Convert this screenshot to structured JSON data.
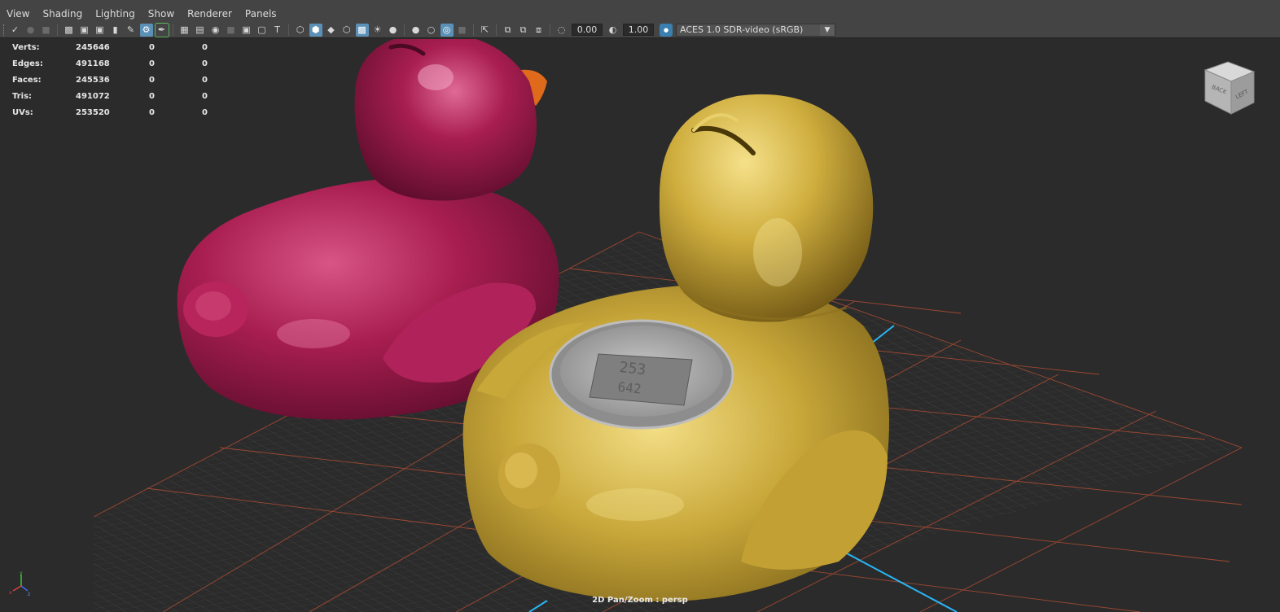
{
  "menubar": {
    "items": [
      "View",
      "Shading",
      "Lighting",
      "Show",
      "Renderer",
      "Panels"
    ]
  },
  "toolbar": {
    "exposure": "0.00",
    "gamma": "1.00",
    "color_space": "ACES 1.0 SDR-video (sRGB)"
  },
  "hud": {
    "rows": [
      {
        "label": "Verts:",
        "value": "245646",
        "z1": "0",
        "z2": "0"
      },
      {
        "label": "Edges:",
        "value": "491168",
        "z1": "0",
        "z2": "0"
      },
      {
        "label": "Faces:",
        "value": "245536",
        "z1": "0",
        "z2": "0"
      },
      {
        "label": "Tris:",
        "value": "491072",
        "z1": "0",
        "z2": "0"
      },
      {
        "label": "UVs:",
        "value": "253520",
        "z1": "0",
        "z2": "0"
      }
    ]
  },
  "viewcube": {
    "face_back": "BACK",
    "face_left": "LEFT"
  },
  "camera_label": "2D Pan/Zoom : persp",
  "colors": {
    "panel_bg": "#444444",
    "viewport_bg": "#2b2b2b",
    "grid_line": "#555555",
    "grid_major": "#c0563a",
    "grid_axis": "#29b6f6",
    "duck_magenta": "#a81e50",
    "duck_yellow": "#c9a83a",
    "beak_orange": "#e06a1c"
  }
}
